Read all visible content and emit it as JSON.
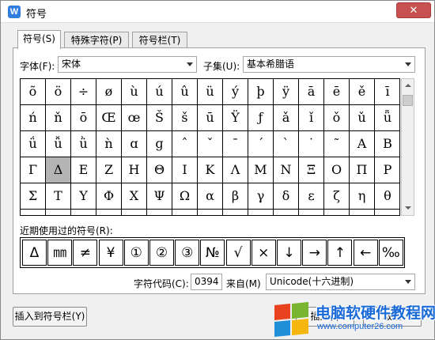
{
  "window": {
    "title": "符号",
    "close_glyph": "✕",
    "app_icon_letter": "W"
  },
  "tabs": [
    {
      "label": "符号(S)",
      "active": true
    },
    {
      "label": "特殊字符(P)",
      "active": false
    },
    {
      "label": "符号栏(T)",
      "active": false
    }
  ],
  "font": {
    "label": "字体(F):",
    "value": "宋体"
  },
  "subset": {
    "label": "子集(U):",
    "value": "基本希腊语"
  },
  "grid": {
    "rows": [
      [
        "õ",
        "ö",
        "÷",
        "ø",
        "ù",
        "ú",
        "û",
        "ü",
        "ý",
        "þ",
        "ÿ",
        "ā",
        "ē",
        "ě",
        "ī"
      ],
      [
        "ń",
        "ň",
        "ō",
        "Œ",
        "œ",
        "Š",
        "š",
        "ū",
        "Ÿ",
        "ƒ",
        "ǎ",
        "ǐ",
        "ǒ",
        "ǔ",
        "ǖ"
      ],
      [
        "ǘ",
        "ǚ",
        "ǜ",
        "ǹ",
        "ɑ",
        "ɡ",
        "ˆ",
        "ˇ",
        "ˉ",
        "ˊ",
        "ˋ",
        "˙",
        "˜",
        "Α",
        "Β"
      ],
      [
        "Γ",
        "Δ",
        "Ε",
        "Ζ",
        "Η",
        "Θ",
        "Ι",
        "Κ",
        "Λ",
        "Μ",
        "Ν",
        "Ξ",
        "Ο",
        "Π",
        "Ρ"
      ],
      [
        "Σ",
        "Τ",
        "Υ",
        "Φ",
        "Χ",
        "Ψ",
        "Ω",
        "α",
        "β",
        "γ",
        "δ",
        "ε",
        "ζ",
        "η",
        "θ"
      ],
      [
        "",
        "",
        "",
        "",
        "",
        "",
        "",
        "",
        "",
        "",
        "",
        "",
        "",
        "",
        ""
      ]
    ],
    "selected": {
      "row": 3,
      "col": 1
    }
  },
  "recent": {
    "label": "近期使用过的符号(R):",
    "items": [
      "Δ",
      "㎜",
      "≠",
      "¥",
      "①",
      "②",
      "③",
      "№",
      "√",
      "×",
      "↓",
      "→",
      "↑",
      "←",
      "‰"
    ]
  },
  "code": {
    "label": "字符代码(C):",
    "value": "0394"
  },
  "from": {
    "label": "来自(M)",
    "value": "Unicode(十六进制)"
  },
  "buttons": {
    "insert_to_bar": "插入到符号栏(Y)",
    "insert": "插入(I)",
    "cancel": "取消"
  },
  "watermark": {
    "main": "电脑软硬件教程网",
    "sub": "www.computer26.com"
  }
}
